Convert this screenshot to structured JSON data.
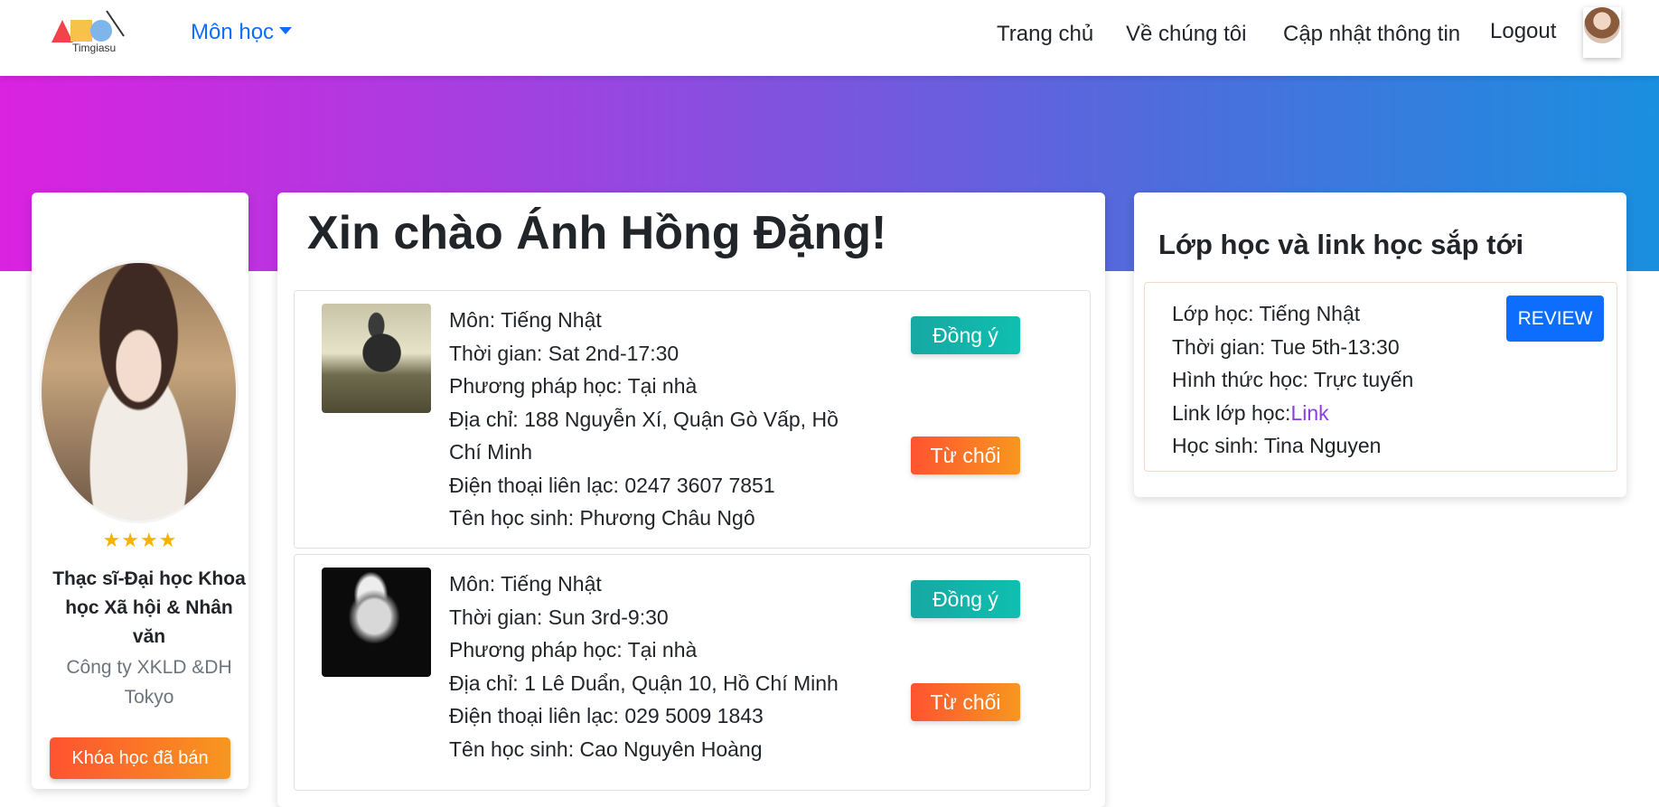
{
  "navbar": {
    "logo_text": "Timgiasu",
    "subject_menu": "Môn học",
    "links": [
      "Trang chủ",
      "Về chúng tôi",
      "Cập nhật thông tin",
      "Logout"
    ]
  },
  "profile": {
    "rating_stars": "★★★★",
    "degree": "Thạc sĩ-Đại học Khoa học Xã hội & Nhân văn",
    "company": "Công ty XKLD &DH Tokyo",
    "sold_courses_button": "Khóa học đã bán"
  },
  "main": {
    "greeting": "Xin chào Ánh Hồng Đặng!",
    "requests": [
      {
        "subject": "Môn: Tiếng Nhật",
        "time": "Thời gian: Sat 2nd-17:30",
        "method": "Phương pháp học: Tại nhà",
        "address": "Địa chỉ: 188 Nguyễn Xí, Quận Gò Vấp, Hồ Chí Minh",
        "phone": "Điện thoại liên lạc: 0247 3607 7851",
        "student": "Tên học sinh: Phương Châu Ngô",
        "accept_label": "Đồng ý",
        "reject_label": "Từ chối"
      },
      {
        "subject": "Môn: Tiếng Nhật",
        "time": "Thời gian: Sun 3rd-9:30",
        "method": "Phương pháp học: Tại nhà",
        "address": "Địa chỉ: 1 Lê Duẩn, Quận 10, Hồ Chí Minh",
        "phone": "Điện thoại liên lạc: 029 5009 1843",
        "student": "Tên học sinh: Cao Nguyên Hoàng",
        "accept_label": "Đồng ý",
        "reject_label": "Từ chối"
      }
    ]
  },
  "upcoming": {
    "title": "Lớp học và link học sắp tới",
    "class": "Lớp học: Tiếng Nhật",
    "time": "Thời gian: Tue 5th-13:30",
    "format": "Hình thức học: Trực tuyến",
    "link_prefix": "Link lớp học:",
    "link_text": "Link",
    "student": "Học sinh: Tina Nguyen",
    "review_label": "REVIEW"
  },
  "colors": {
    "primary": "#0d6efd",
    "accept": "#17a8a3",
    "reject": "#ff5330",
    "link": "#8a3ee0",
    "stars": "#f5b301"
  }
}
